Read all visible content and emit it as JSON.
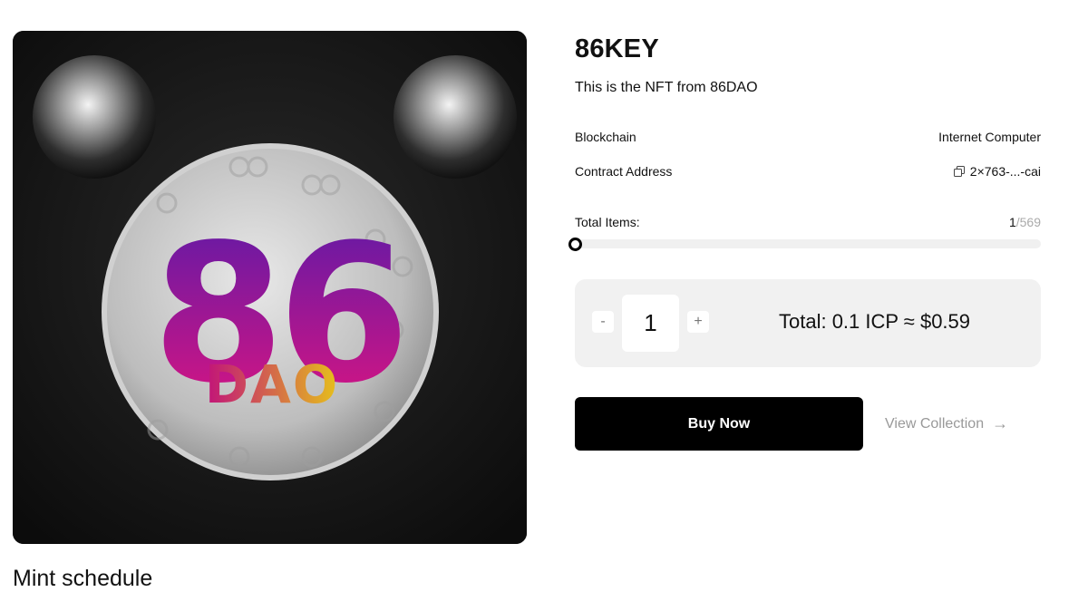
{
  "nft": {
    "title": "86KEY",
    "description": "This is the NFT from 86DAO",
    "image_alt": "86DAO key badge artwork"
  },
  "details": {
    "blockchain_label": "Blockchain",
    "blockchain_value": "Internet Computer",
    "contract_label": "Contract Address",
    "contract_value": "2×763-...-cai"
  },
  "supply": {
    "label": "Total Items:",
    "minted": "1",
    "separator": "/",
    "max": "569",
    "progress_fraction": 0.0018
  },
  "purchase": {
    "minus_label": "-",
    "plus_label": "+",
    "quantity": "1",
    "total_text": "Total: 0.1 ICP ≈ $0.59",
    "buy_label": "Buy Now",
    "view_collection_label": "View Collection",
    "arrow_glyph": "→"
  },
  "artwork_text": {
    "big": "86",
    "small": "DAO"
  },
  "sections": {
    "mint_schedule_heading": "Mint schedule"
  },
  "colors": {
    "accent": "#000000",
    "panel_bg": "#f1f1f1",
    "muted_text": "#999999"
  }
}
